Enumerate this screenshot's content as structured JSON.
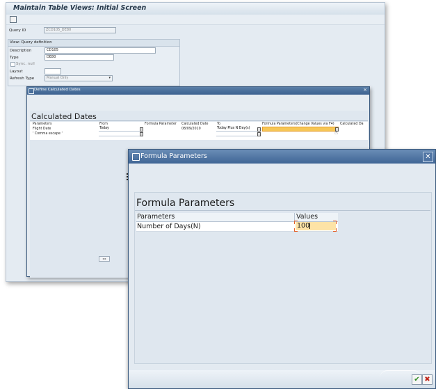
{
  "main_window": {
    "title": "Maintain Table Views: Initial Screen",
    "fields": {
      "query_id_label": "Query ID",
      "query_id_value": "ZCD105_DE80",
      "group_title": "View: Query definition",
      "description_label": "Description",
      "description_value": "CD105",
      "type_label": "Type",
      "type_value": "DE80",
      "sync_null_label": "Sync. null",
      "layout_label": "Layout",
      "refresh_type_label": "Refresh Type",
      "refresh_type_value": "Manual Only"
    }
  },
  "calc_dialog": {
    "title": "Define Calculated Dates",
    "heading": "Calculated Dates",
    "columns": [
      "Parameters",
      "From",
      "Formula Parameter",
      "Calculated Date",
      "To",
      "Formula Parameters(Change Values via F4)",
      "Calculated Da"
    ],
    "rows": [
      {
        "parameter": "Flight Date",
        "from": "Today",
        "calculated_date": "08/09/2010",
        "to": "Today Plus N Day(s)"
      },
      {
        "parameter": "' Comma escape '",
        "from": "",
        "calculated_date": "",
        "to": ""
      }
    ]
  },
  "formula_dialog": {
    "title": "Formula Parameters",
    "heading": "Formula Parameters",
    "col_parameters": "Parameters",
    "col_values": "Values",
    "row_label": "Number of Days(N)",
    "row_value": "100",
    "ok_icon": "check-icon",
    "cancel_icon": "cancel-icon"
  }
}
